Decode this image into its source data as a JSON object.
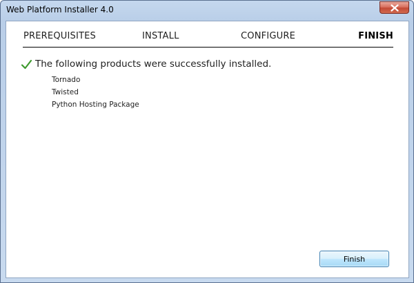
{
  "window": {
    "title": "Web Platform Installer 4.0"
  },
  "steps": [
    {
      "label": "PREREQUISITES",
      "active": false
    },
    {
      "label": "INSTALL",
      "active": false
    },
    {
      "label": "CONFIGURE",
      "active": false
    },
    {
      "label": "FINISH",
      "active": true
    }
  ],
  "status": {
    "icon": "checkmark-icon",
    "message": "The following products were successfully installed.",
    "color": "#3e9a2e"
  },
  "products": [
    "Tornado",
    "Twisted",
    "Python Hosting Package"
  ],
  "buttons": {
    "finish_label": "Finish"
  },
  "colors": {
    "close_button": "#c44a36",
    "button_border": "#3c7fb1",
    "frame": "#c5d8ee"
  }
}
